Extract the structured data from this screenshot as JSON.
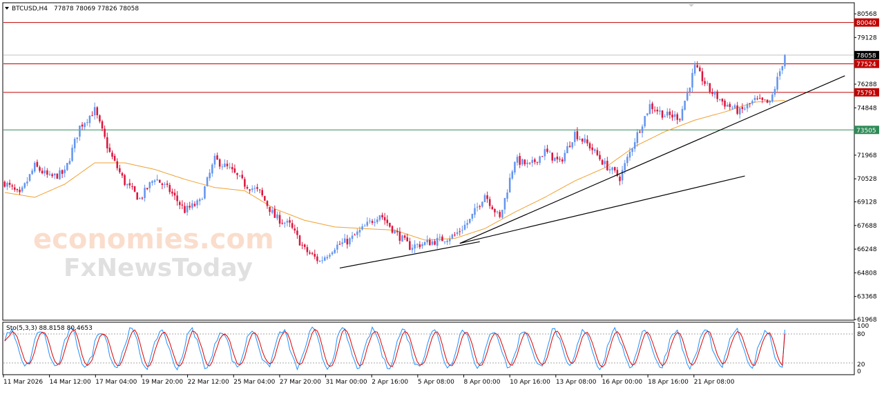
{
  "header": {
    "symbol_label": "BTCUSD,H4",
    "ohlc_values": "77878 78069 77826 78058"
  },
  "stochastic": {
    "label": "Sto(5,3,3) 88.8158 80.4653",
    "scale_labels": [
      "100",
      "80",
      "20",
      "0"
    ]
  },
  "watermark": {
    "line1": "economies.com",
    "line2": "FxNewsToday"
  },
  "colors": {
    "bull": "#6495ed",
    "bear": "#dc143c",
    "ma": "#f0a030",
    "resistance": "#c00000",
    "support_green": "#2e8b57",
    "trendline": "#000000",
    "stoch_main": "#1e90ff",
    "stoch_signal": "#e00000"
  },
  "chart_data": {
    "type": "candlestick",
    "symbol": "BTCUSD",
    "timeframe": "H4",
    "ylim": [
      61968,
      81200
    ],
    "y_ticks": [
      "80568",
      "79128",
      "76288",
      "74848",
      "71968",
      "70528",
      "69128",
      "67688",
      "66248",
      "64808",
      "63368",
      "61968"
    ],
    "x_ticks": [
      "11 Mar 2026",
      "14 Mar 12:00",
      "17 Mar 04:00",
      "19 Mar 20:00",
      "22 Mar 12:00",
      "25 Mar 04:00",
      "27 Mar 20:00",
      "31 Mar 00:00",
      "2 Apr 16:00",
      "5 Apr 08:00",
      "8 Apr 00:00",
      "10 Apr 16:00",
      "13 Apr 08:00",
      "16 Apr 00:00",
      "18 Apr 16:00",
      "21 Apr 08:00"
    ],
    "last_price": "78058",
    "levels": [
      {
        "label": "80040",
        "value": 80040,
        "color": "#c00000"
      },
      {
        "label": "77524",
        "value": 77524,
        "color": "#c00000"
      },
      {
        "label": "75791",
        "value": 75791,
        "color": "#c00000"
      },
      {
        "label": "73505",
        "value": 73505,
        "color": "#2e8b57"
      }
    ],
    "close_path": [
      [
        0,
        70300
      ],
      [
        6,
        69500
      ],
      [
        12,
        71300
      ],
      [
        18,
        70600
      ],
      [
        24,
        70900
      ],
      [
        30,
        73700
      ],
      [
        36,
        74700
      ],
      [
        42,
        72100
      ],
      [
        48,
        70300
      ],
      [
        54,
        69300
      ],
      [
        60,
        70600
      ],
      [
        66,
        69800
      ],
      [
        72,
        68600
      ],
      [
        78,
        69100
      ],
      [
        84,
        71700
      ],
      [
        90,
        71100
      ],
      [
        96,
        70200
      ],
      [
        102,
        69700
      ],
      [
        108,
        68200
      ],
      [
        114,
        67700
      ],
      [
        120,
        66200
      ],
      [
        126,
        65500
      ],
      [
        132,
        66400
      ],
      [
        138,
        66800
      ],
      [
        144,
        67600
      ],
      [
        150,
        68400
      ],
      [
        156,
        67300
      ],
      [
        162,
        66400
      ],
      [
        168,
        66600
      ],
      [
        174,
        66800
      ],
      [
        180,
        67100
      ],
      [
        186,
        68000
      ],
      [
        192,
        69600
      ],
      [
        198,
        68100
      ],
      [
        204,
        71700
      ],
      [
        210,
        71300
      ],
      [
        216,
        72200
      ],
      [
        222,
        71500
      ],
      [
        228,
        73300
      ],
      [
        234,
        72500
      ],
      [
        240,
        71400
      ],
      [
        246,
        70600
      ],
      [
        252,
        72900
      ],
      [
        258,
        75000
      ],
      [
        264,
        74400
      ],
      [
        270,
        74300
      ],
      [
        276,
        77300
      ],
      [
        282,
        75900
      ],
      [
        288,
        75100
      ],
      [
        294,
        74600
      ],
      [
        300,
        75300
      ],
      [
        306,
        75100
      ],
      [
        312,
        78058
      ]
    ],
    "ma_path": [
      [
        0,
        69700
      ],
      [
        12,
        69400
      ],
      [
        24,
        70200
      ],
      [
        36,
        71500
      ],
      [
        48,
        71500
      ],
      [
        60,
        71100
      ],
      [
        72,
        70500
      ],
      [
        84,
        70000
      ],
      [
        96,
        69800
      ],
      [
        108,
        68700
      ],
      [
        120,
        68000
      ],
      [
        132,
        67600
      ],
      [
        144,
        67500
      ],
      [
        156,
        67400
      ],
      [
        168,
        66800
      ],
      [
        180,
        66900
      ],
      [
        192,
        67500
      ],
      [
        204,
        68500
      ],
      [
        216,
        69400
      ],
      [
        228,
        70400
      ],
      [
        240,
        71200
      ],
      [
        252,
        72500
      ],
      [
        264,
        73400
      ],
      [
        276,
        74100
      ],
      [
        288,
        74600
      ],
      [
        300,
        75200
      ],
      [
        312,
        75300
      ]
    ],
    "trendlines": [
      {
        "from": [
          134,
          65100
        ],
        "to": [
          190,
          66700
        ]
      },
      {
        "from": [
          182,
          66600
        ],
        "to": [
          336,
          76800
        ]
      },
      {
        "from": [
          182,
          66600
        ],
        "to": [
          296,
          70700
        ]
      }
    ],
    "stochastic_ylim": [
      0,
      100
    ],
    "stochastic_levels": [
      20,
      80
    ],
    "stochastic_last": {
      "main": 88.8158,
      "signal": 80.4653
    }
  }
}
